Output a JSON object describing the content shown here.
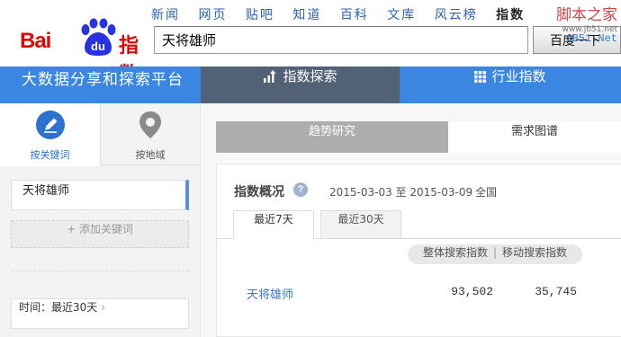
{
  "header": {
    "logo": {
      "text_bai": "Bai",
      "text_du": "du",
      "text_index": "指数"
    },
    "nav": [
      "新闻",
      "网页",
      "贴吧",
      "知道",
      "百科",
      "文库",
      "风云榜",
      "指数"
    ],
    "nav_active_index": 7,
    "search_value": "天将雄师",
    "search_button": "百度一下",
    "watermark": {
      "line1": "脚本之家",
      "line2": "www.jb51.net",
      "line3": "JB51.Net"
    }
  },
  "bluebar": {
    "platform_title": "大数据分享和探索平台",
    "tab_explore": "指数探索",
    "tab_industry": "行业指数"
  },
  "sidebar": {
    "tab_keyword": "按关键词",
    "tab_region": "按地域",
    "keyword": "天将雄师",
    "add_keyword": "+ 添加关键词",
    "time_label": "时间：最近30天",
    "time_arrow": "›"
  },
  "main": {
    "tab_trend": "趋势研究",
    "tab_demand": "需求图谱",
    "overview_title": "指数概况",
    "help_icon": "?",
    "date_range": "2015-03-03 至 2015-03-09",
    "region": "全国",
    "period_7": "最近7天",
    "period_30": "最近30天",
    "metric_total": "整体搜索指数",
    "metric_sep": "|",
    "metric_mobile": "移动搜索指数",
    "row": {
      "keyword": "天将雄师",
      "total": "93,502",
      "mobile": "35,745"
    }
  },
  "colors": {
    "brand_red": "#e10602",
    "brand_blue": "#2932e1",
    "nav_bar_blue": "#3b86e0",
    "active_tab_slate": "#516276",
    "link_blue": "#3a78c9"
  }
}
